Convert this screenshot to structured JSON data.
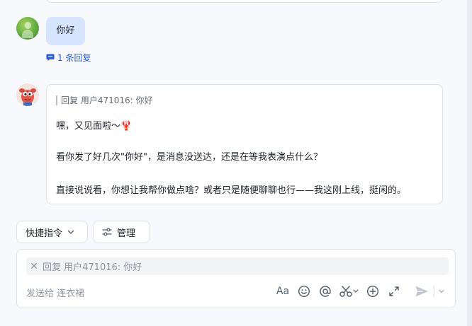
{
  "thread": {
    "user_message": {
      "text": "你好"
    },
    "reply_count_label": "1 条回复",
    "bot_message": {
      "quote": "回复 用户471016: 你好",
      "line1": "嘿，又见面啦～🦞",
      "line2": "看你发了好几次\"你好\"，是消息没送达，还是在等我表演点什么？",
      "line3": "直接说说看，你想让我帮你做点啥？或者只是随便聊聊也行——我这刚上线，挺闲的。"
    }
  },
  "actions": {
    "quick_commands_label": "快捷指令",
    "manage_label": "管理"
  },
  "composer": {
    "reply_chip_label": "回复 用户471016: 你好",
    "send_to_label": "发送给 连衣裙",
    "font_button_label": "Aa"
  },
  "colors": {
    "accent": "#2b5bd7",
    "user_bubble": "#d6e4ff",
    "panel_background": "#f8f9fc",
    "page_background": "#e9ecf3"
  },
  "icons": {
    "reply": "chat-bubble-icon",
    "quick_commands_dropdown": "chevron-down-icon",
    "manage": "sliders-icon",
    "close": "close-icon",
    "emoji": "smile-icon",
    "mention": "at-icon",
    "screenshot": "scissors-icon",
    "add": "plus-circle-icon",
    "expand": "expand-icon",
    "send": "send-icon",
    "more": "chevron-down-icon"
  }
}
